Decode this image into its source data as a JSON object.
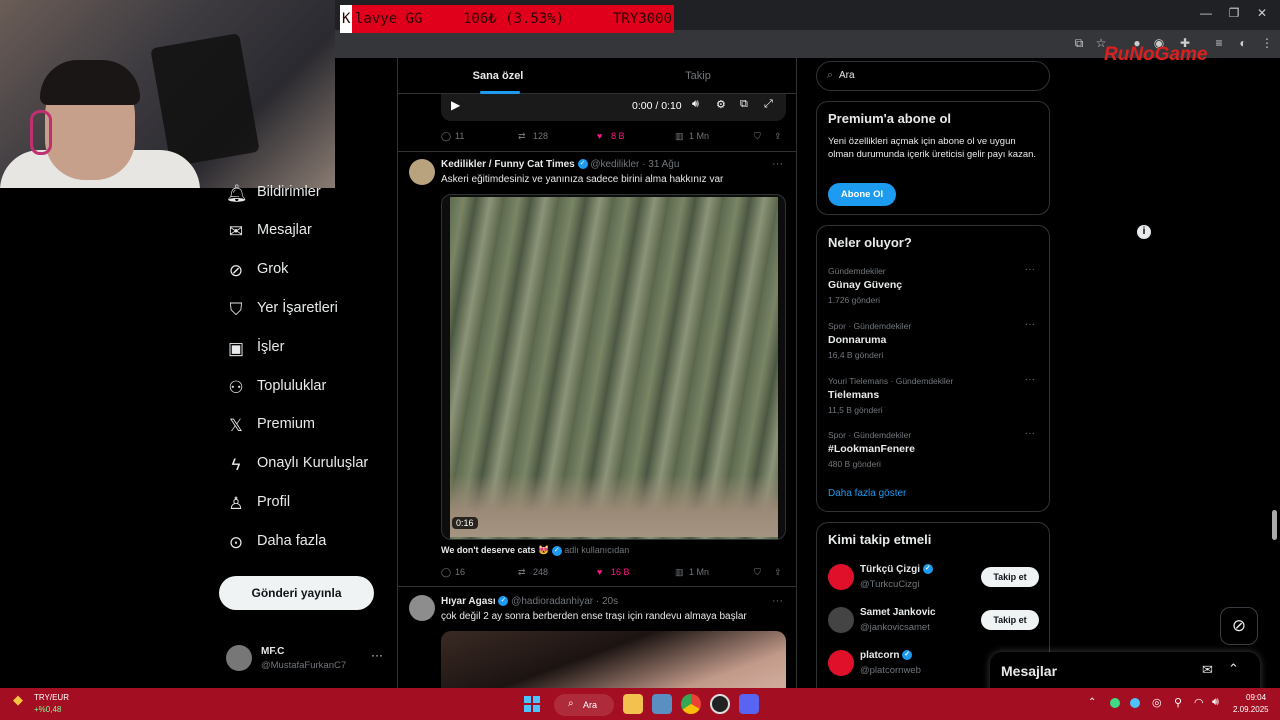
{
  "overlay": {
    "k": "K",
    "left": "lavye GG",
    "mid": "106₺ (3.53%)",
    "right": "TRY3000"
  },
  "brand": {
    "logo": "RuNoGame"
  },
  "feed": {
    "tabs": [
      "Sana özel",
      "Takip"
    ],
    "video_time": "0:00 / 0:10",
    "first_actions": {
      "replies": "11",
      "reposts": "128",
      "likes": "8 B",
      "views": "1 Mn"
    },
    "tweets": [
      {
        "author": "Kedilikler / Funny Cat Times",
        "handle": "@kedilikler",
        "time": "· 31 Ağu",
        "text": "Askeri eğitimdesiniz ve yanınıza sadece birini alma hakkınız var",
        "video_duration": "0:16",
        "caption": "We don't deserve cats 😻",
        "caption_suffix": "adlı kullanıcıdan",
        "replies": "16",
        "reposts": "248",
        "likes": "16 B",
        "views": "1 Mn"
      },
      {
        "author": "Hıyar Agası",
        "handle": "@hadioradanhiyar",
        "time": "· 20s",
        "text": "çok değil 2 ay sonra berberden ense traşı için randevu almaya başlar"
      }
    ]
  },
  "nav": {
    "items": [
      {
        "label": "Bildirimler",
        "icon": "bell-icon"
      },
      {
        "label": "Mesajlar",
        "icon": "mail-icon"
      },
      {
        "label": "Grok",
        "icon": "grok-icon"
      },
      {
        "label": "Yer İşaretleri",
        "icon": "bookmark-icon"
      },
      {
        "label": "İşler",
        "icon": "briefcase-icon"
      },
      {
        "label": "Topluluklar",
        "icon": "people-icon"
      },
      {
        "label": "Premium",
        "icon": "x-logo-icon"
      },
      {
        "label": "Onaylı Kuruluşlar",
        "icon": "lightning-icon"
      },
      {
        "label": "Profil",
        "icon": "person-icon"
      },
      {
        "label": "Daha fazla",
        "icon": "more-icon"
      }
    ],
    "post_button": "Gönderi yayınla",
    "user": {
      "name": "MF.C",
      "handle": "@MustafaFurkanC7"
    }
  },
  "search": {
    "placeholder": "Ara"
  },
  "premium": {
    "title": "Premium'a abone ol",
    "body": "Yeni özellikleri açmak için abone ol ve uygun olman durumunda içerik üreticisi gelir payı kazan.",
    "button": "Abone Ol"
  },
  "trends": {
    "title": "Neler oluyor?",
    "items": [
      {
        "category": "Gündemdekiler",
        "name": "Günay Güvenç",
        "count": "1.726 gönderi"
      },
      {
        "category": "Spor · Gündemdekiler",
        "name": "Donnaruma",
        "count": "16,4 B gönderi"
      },
      {
        "category": "Youri Tielemans · Gündemdekiler",
        "name": "Tielemans",
        "count": "11,5 B gönderi"
      },
      {
        "category": "Spor · Gündemdekiler",
        "name": "#LookmanFenere",
        "count": "480 B gönderi"
      }
    ],
    "show_more": "Daha fazla göster"
  },
  "who_to_follow": {
    "title": "Kimi takip etmeli",
    "follow_label": "Takip et",
    "accounts": [
      {
        "name": "Türkçü Çizgi",
        "handle": "@TurkcuCizgi",
        "color": "#e0102b"
      },
      {
        "name": "Samet Jankovic",
        "handle": "@jankovicsamet",
        "color": "#444444"
      },
      {
        "name": "platcorn",
        "handle": "@platcornweb",
        "color": "#e0102b"
      }
    ]
  },
  "messages_drawer": {
    "title": "Mesajlar"
  },
  "taskbar": {
    "currency": "TRY/EUR",
    "currency_change": "+%0,48",
    "search": "Ara",
    "time": "09:04",
    "date": "2.09.2025"
  }
}
